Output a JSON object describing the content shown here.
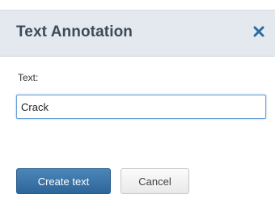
{
  "dialog": {
    "title": "Text Annotation",
    "close_icon": "close-icon"
  },
  "form": {
    "text_label": "Text:",
    "text_value": "Crack"
  },
  "actions": {
    "create_label": "Create text",
    "cancel_label": "Cancel"
  },
  "colors": {
    "header_bg": "#e3e9ee",
    "title_text": "#3d4a58",
    "close_icon": "#2f6a9e",
    "primary_button": "#3a73a8",
    "input_focus_border": "#6aa0d8"
  }
}
